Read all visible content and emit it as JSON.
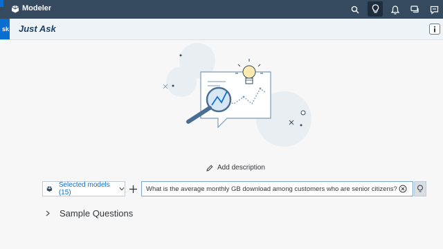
{
  "shell": {
    "app_title": "Modeler",
    "icons": [
      "search-icon",
      "lightbulb-question-icon",
      "bell-icon",
      "chat-icon",
      "help-icon"
    ]
  },
  "header": {
    "tab_label": "sk",
    "title": "Just Ask"
  },
  "illustration": {
    "icons": [
      "lightbulb-icon",
      "magnifier-icon",
      "line-chart-icon"
    ]
  },
  "description": {
    "link_label": "Add description"
  },
  "query": {
    "models_label": "Selected models (15)",
    "input_value": "What is the average monthly GB download among customers who are senior citizens?"
  },
  "sample": {
    "label": "Sample Questions"
  }
}
